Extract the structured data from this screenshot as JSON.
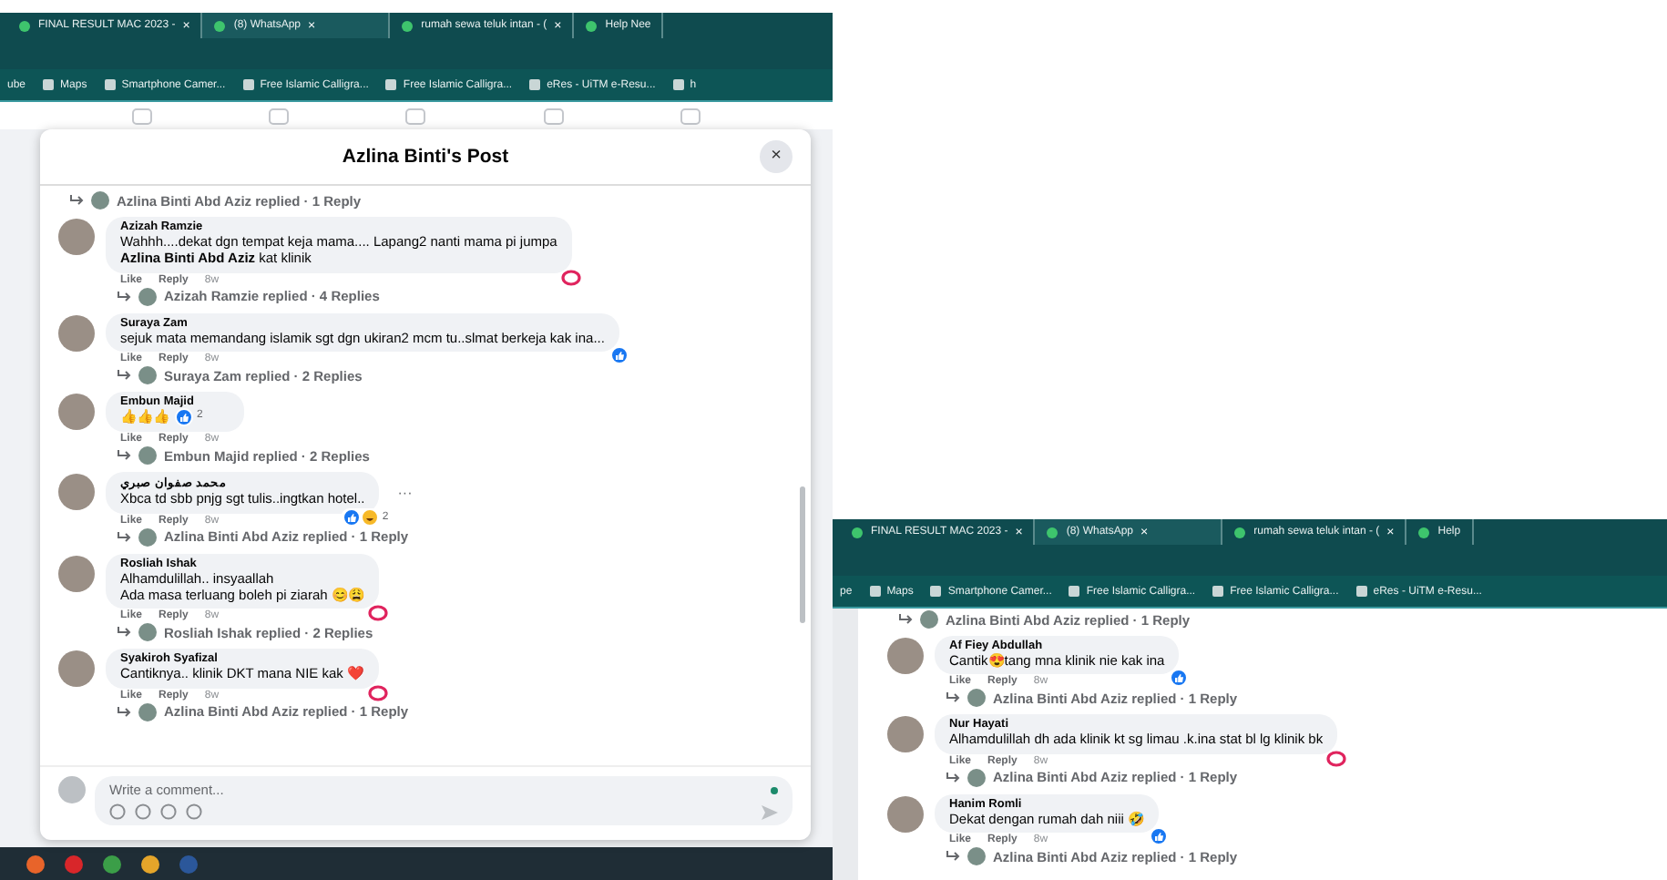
{
  "panels": [
    {
      "tabs": [
        {
          "title": "FINAL RESULT MAC 2023 -",
          "selected": false
        },
        {
          "title": "(8) WhatsApp",
          "selected": true
        },
        {
          "title": "rumah sewa teluk intan - (",
          "selected": false
        },
        {
          "title": "Help Nee",
          "selected": false
        }
      ],
      "tab_close": "×",
      "bookmarks": [
        "ube",
        "Maps",
        "Smartphone Camer...",
        "Free Islamic Calligra...",
        "Free Islamic Calligra...",
        "eRes - UiTM e-Resu...",
        "h"
      ],
      "dialog": {
        "title": "Azlina Binti's Post",
        "close": "×",
        "composer_placeholder": "Write a comment..."
      },
      "comments": [
        {
          "replies": "Azlina Binti Abd Aziz replied · 1 Reply"
        },
        {
          "author": "Azizah Ramzie",
          "text": "Wahhh....dekat dgn tempat keja mama.... Lapang2 nanti mama pi jumpa\n**Azlina Binti Abd Aziz** kat klinik",
          "reactions": [
            {
              "kind": "heart"
            }
          ],
          "actions": [
            "Like",
            "Reply",
            "8w"
          ],
          "replies": "Azizah Ramzie replied · 4 Replies"
        },
        {
          "author": "Suraya Zam",
          "text": "sejuk mata memandang islamik sgt dgn ukiran2 mcm tu..slmat berkeja kak ina...",
          "reactions": [
            {
              "kind": "like"
            }
          ],
          "actions": [
            "Like",
            "Reply",
            "8w"
          ],
          "replies": "Suraya Zam replied · 2 Replies"
        },
        {
          "author": "Embun Majid",
          "text": "👍👍👍",
          "inline_reactions": [
            {
              "kind": "like"
            }
          ],
          "reaction_count": "2",
          "actions": [
            "Like",
            "Reply",
            "8w"
          ],
          "replies": "Embun Majid replied · 2 Replies"
        },
        {
          "author": "محمد صفوان صبري",
          "text": "Xbca td sbb pnjg sgt tulis..ingtkan hotel..",
          "reactions": [
            {
              "kind": "like"
            },
            {
              "kind": "haha"
            }
          ],
          "reaction_count": "2",
          "more": "···",
          "actions": [
            "Like",
            "Reply",
            "8w"
          ],
          "replies": "Azlina Binti Abd Aziz replied · 1 Reply"
        },
        {
          "author": "Rosliah Ishak",
          "text": "Alhamdulillah.. insyaallah\nAda masa terluang boleh pi ziarah 😊😩",
          "reactions": [
            {
              "kind": "heart"
            }
          ],
          "actions": [
            "Like",
            "Reply",
            "8w"
          ],
          "replies": "Rosliah Ishak replied · 2 Replies"
        },
        {
          "author": "Syakiroh Syafizal",
          "text": "Cantiknya.. klinik DKT mana NIE kak ❤️",
          "reactions": [
            {
              "kind": "heart"
            }
          ],
          "actions": [
            "Like",
            "Reply",
            "8w"
          ],
          "replies": "Azlina Binti Abd Aziz replied · 1 Reply"
        }
      ]
    },
    {
      "tabs": [
        {
          "title": "FINAL RESULT MAC 2023 -",
          "selected": false
        },
        {
          "title": "(8) WhatsApp",
          "selected": true
        },
        {
          "title": "rumah sewa teluk intan - (",
          "selected": false
        },
        {
          "title": "Help",
          "selected": false
        }
      ],
      "tab_close": "×",
      "bookmarks": [
        "pe",
        "Maps",
        "Smartphone Camer...",
        "Free Islamic Calligra...",
        "Free Islamic Calligra...",
        "eRes - UiTM e-Resu..."
      ],
      "comments": [
        {
          "replies": "Azlina Binti Abd Aziz replied · 1 Reply"
        },
        {
          "author": "Af Fiey Abdullah",
          "text": "Cantik😍tang mna klinik nie kak ina",
          "reactions": [
            {
              "kind": "like"
            }
          ],
          "actions": [
            "Like",
            "Reply",
            "8w"
          ],
          "replies": "Azlina Binti Abd Aziz replied · 1 Reply"
        },
        {
          "author": "Nur Hayati",
          "text": "Alhamdulillah dh ada klinik kt sg limau .k.ina stat bl lg klinik bk",
          "reactions": [
            {
              "kind": "heart"
            }
          ],
          "actions": [
            "Like",
            "Reply",
            "8w"
          ],
          "replies": "Azlina Binti Abd Aziz replied · 1 Reply"
        },
        {
          "author": "Hanim Romli",
          "text": "Dekat dengan rumah dah niii 🤣",
          "reactions": [
            {
              "kind": "like"
            }
          ],
          "actions": [
            "Like",
            "Reply",
            "8w"
          ],
          "replies": "Azlina Binti Abd Aziz replied · 1 Reply"
        }
      ]
    }
  ]
}
